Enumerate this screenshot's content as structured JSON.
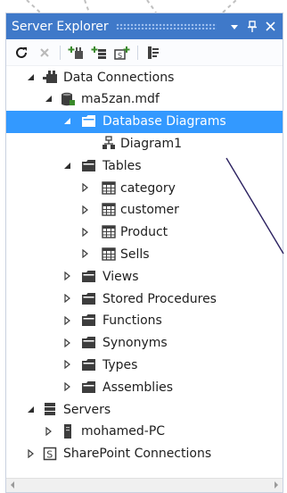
{
  "panel": {
    "title": "Server Explorer"
  },
  "titlebar_buttons": {
    "dropdown": "▾",
    "pin": "ᵖ",
    "close": "×"
  },
  "toolbar": {
    "icons": [
      "refresh-icon",
      "stop-icon",
      "connect-to-database-icon",
      "connect-to-server-icon",
      "connect-to-sharepoint-icon",
      "properties-icon"
    ]
  },
  "tree": [
    {
      "label": "Data Connections",
      "level": 0,
      "expander": "expanded",
      "icon": "data-connections-icon"
    },
    {
      "label": "ma5zan.mdf",
      "level": 1,
      "expander": "expanded",
      "icon": "database-icon"
    },
    {
      "label": "Database Diagrams",
      "level": 2,
      "expander": "expanded",
      "icon": "folder-icon",
      "selected": true
    },
    {
      "label": "Diagram1",
      "level": 3,
      "expander": "none",
      "icon": "diagram-icon"
    },
    {
      "label": "Tables",
      "level": 2,
      "expander": "expanded",
      "icon": "folder-icon"
    },
    {
      "label": "category",
      "level": 3,
      "expander": "collapsed",
      "icon": "table-icon"
    },
    {
      "label": "customer",
      "level": 3,
      "expander": "collapsed",
      "icon": "table-icon"
    },
    {
      "label": "Product",
      "level": 3,
      "expander": "collapsed",
      "icon": "table-icon"
    },
    {
      "label": "Sells",
      "level": 3,
      "expander": "collapsed",
      "icon": "table-icon"
    },
    {
      "label": "Views",
      "level": 2,
      "expander": "collapsed",
      "icon": "folder-icon"
    },
    {
      "label": "Stored Procedures",
      "level": 2,
      "expander": "collapsed",
      "icon": "folder-icon"
    },
    {
      "label": "Functions",
      "level": 2,
      "expander": "collapsed",
      "icon": "folder-icon"
    },
    {
      "label": "Synonyms",
      "level": 2,
      "expander": "collapsed",
      "icon": "folder-icon"
    },
    {
      "label": "Types",
      "level": 2,
      "expander": "collapsed",
      "icon": "folder-icon"
    },
    {
      "label": "Assemblies",
      "level": 2,
      "expander": "collapsed",
      "icon": "folder-icon"
    },
    {
      "label": "Servers",
      "level": 0,
      "expander": "expanded",
      "icon": "servers-icon"
    },
    {
      "label": "mohamed-PC",
      "level": 1,
      "expander": "collapsed",
      "icon": "server-icon"
    },
    {
      "label": "SharePoint Connections",
      "level": 0,
      "expander": "collapsed",
      "icon": "sharepoint-icon"
    }
  ],
  "colors": {
    "titlebar": "#3f79c9",
    "selection": "#3399ff",
    "annotation_line": "#2b2160"
  }
}
